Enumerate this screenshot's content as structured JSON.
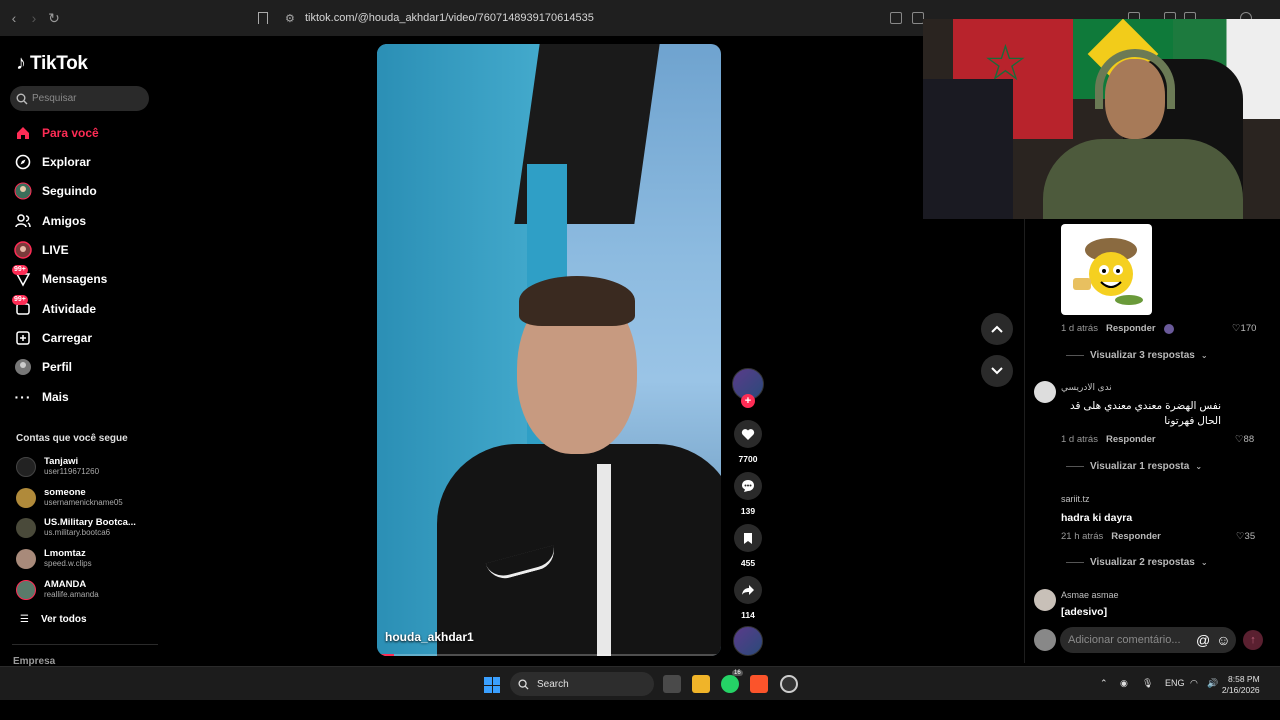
{
  "browser": {
    "url": "tiktok.com/@houda_akhdar1/video/7607148939170614535"
  },
  "sidebar": {
    "logo": "TikTok",
    "search_placeholder": "Pesquisar",
    "nav": [
      {
        "label": "Para você",
        "icon": "home-icon",
        "active": true
      },
      {
        "label": "Explorar",
        "icon": "compass-icon"
      },
      {
        "label": "Seguindo",
        "icon": "following-icon"
      },
      {
        "label": "Amigos",
        "icon": "friends-icon"
      },
      {
        "label": "LIVE",
        "icon": "live-icon"
      },
      {
        "label": "Mensagens",
        "icon": "message-icon",
        "badge": "99+"
      },
      {
        "label": "Atividade",
        "icon": "activity-icon",
        "badge": "99+"
      },
      {
        "label": "Carregar",
        "icon": "upload-icon"
      },
      {
        "label": "Perfil",
        "icon": "profile-icon"
      },
      {
        "label": "Mais",
        "icon": "more-icon"
      }
    ],
    "following_title": "Contas que você segue",
    "following": [
      {
        "name": "Tanjawi",
        "user": "user119671260"
      },
      {
        "name": "someone",
        "user": "usernamenickname05"
      },
      {
        "name": "US.Military Bootca...",
        "user": "us.military.bootca6"
      },
      {
        "name": "Lmomtaz",
        "user": "speed.w.clips"
      },
      {
        "name": "AMANDA",
        "user": "reallife.amanda"
      }
    ],
    "see_all": "Ver todos",
    "company": "Empresa"
  },
  "video": {
    "author": "houda_akhdar1",
    "progress": 0.05
  },
  "actions": {
    "likes": "7700",
    "comments": "139",
    "saves": "455",
    "shares": "114",
    "follow_plus": "+"
  },
  "comments": [
    {
      "time": "1 d atrás",
      "reply": "Responder",
      "likes": "170",
      "view_replies": "Visualizar 3 respostas"
    },
    {
      "author": "ندى الادريسي",
      "text": "نفس الهضرة معندي معندي هلى قد الحال فهرتونا",
      "time": "1 d atrás",
      "reply": "Responder",
      "likes": "88",
      "view_replies": "Visualizar 1 resposta"
    },
    {
      "author": "sariit.tz",
      "text": "hadra ki dayra",
      "time": "21 h atrás",
      "reply": "Responder",
      "likes": "35",
      "view_replies": "Visualizar 2 respostas"
    },
    {
      "author": "Asmae asmae",
      "text": "[adesivo]"
    }
  ],
  "comment_input": {
    "placeholder": "Adicionar comentário..."
  },
  "taskbar": {
    "search": "Search",
    "lang": "ENG",
    "time": "8:58 PM",
    "date": "2/16/2026",
    "whatsapp_badge": "16"
  },
  "colors": {
    "accent": "#fe2c55",
    "background": "#000000"
  }
}
